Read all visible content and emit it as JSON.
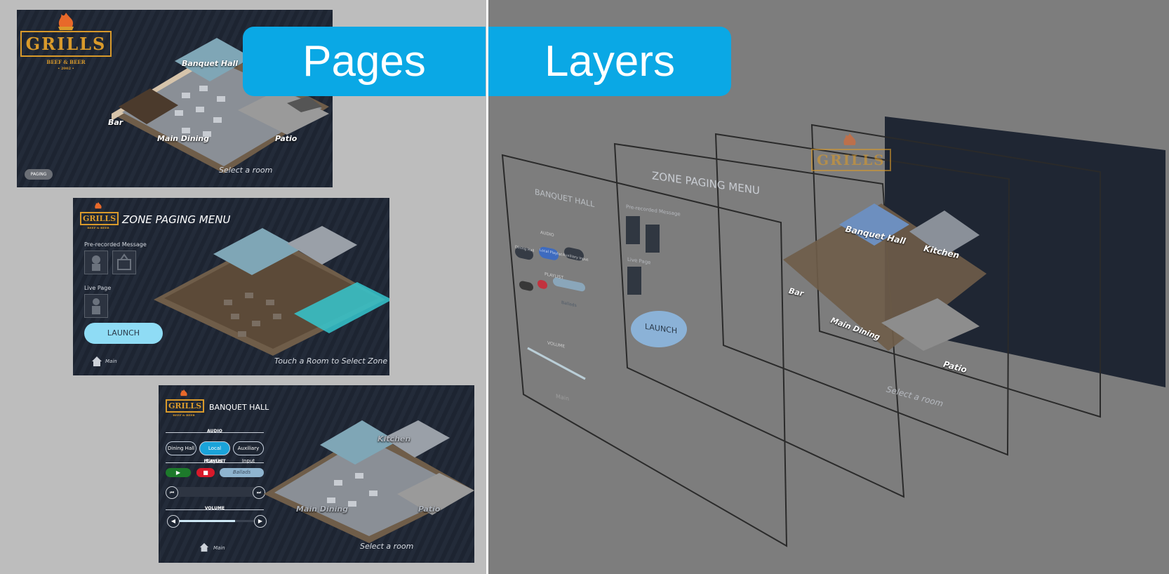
{
  "banners": {
    "pages": "Pages",
    "layers": "Layers"
  },
  "logo": {
    "word": "GRILLS",
    "tagline": "BEEF & BEER",
    "year": "• 2002 •"
  },
  "rooms": {
    "banquet": "Banquet Hall",
    "bar": "Bar",
    "main_dining": "Main Dining",
    "patio": "Patio",
    "kitchen": "Kitchen"
  },
  "screen1": {
    "hint": "Select a room",
    "paging_button": "PAGING"
  },
  "screen2": {
    "title": "ZONE PAGING MENU",
    "prerecorded_label": "Pre-recorded Message",
    "live_label": "Live Page",
    "launch": "LAUNCH",
    "home_label": "Main",
    "hint": "Touch a Room to Select Zone"
  },
  "screen3": {
    "title": "BANQUET HALL",
    "audio_label": "AUDIO",
    "sources": [
      "Dining Hall",
      "Local Playlist",
      "Auxiliary Input"
    ],
    "playlist_label": "PLAYLIST",
    "playlist_value": "Ballads",
    "volume_label": "VOLUME",
    "volume_level": 0.75,
    "home_label": "Main",
    "hint": "Select a room"
  },
  "layers": {
    "l1_title": "BANQUET HALL",
    "l1_audio": "AUDIO",
    "l1_sources": [
      "Dining Hall",
      "Local Playlist",
      "Auxiliary Input"
    ],
    "l1_playlist": "PLAYLIST",
    "l1_playlist_value": "Ballads",
    "l1_volume": "VOLUME",
    "l1_home": "Main",
    "l2_title": "ZONE PAGING MENU",
    "l2_prerecorded": "Pre-recorded Message",
    "l2_live": "Live Page",
    "l2_launch": "LAUNCH",
    "l3_hint": "Select a room"
  },
  "colors": {
    "accent": "#0aa8e5",
    "logo": "#d99a2b",
    "launch": "#8fdcf5",
    "play": "#1d7a2b",
    "stop": "#d8192a"
  }
}
